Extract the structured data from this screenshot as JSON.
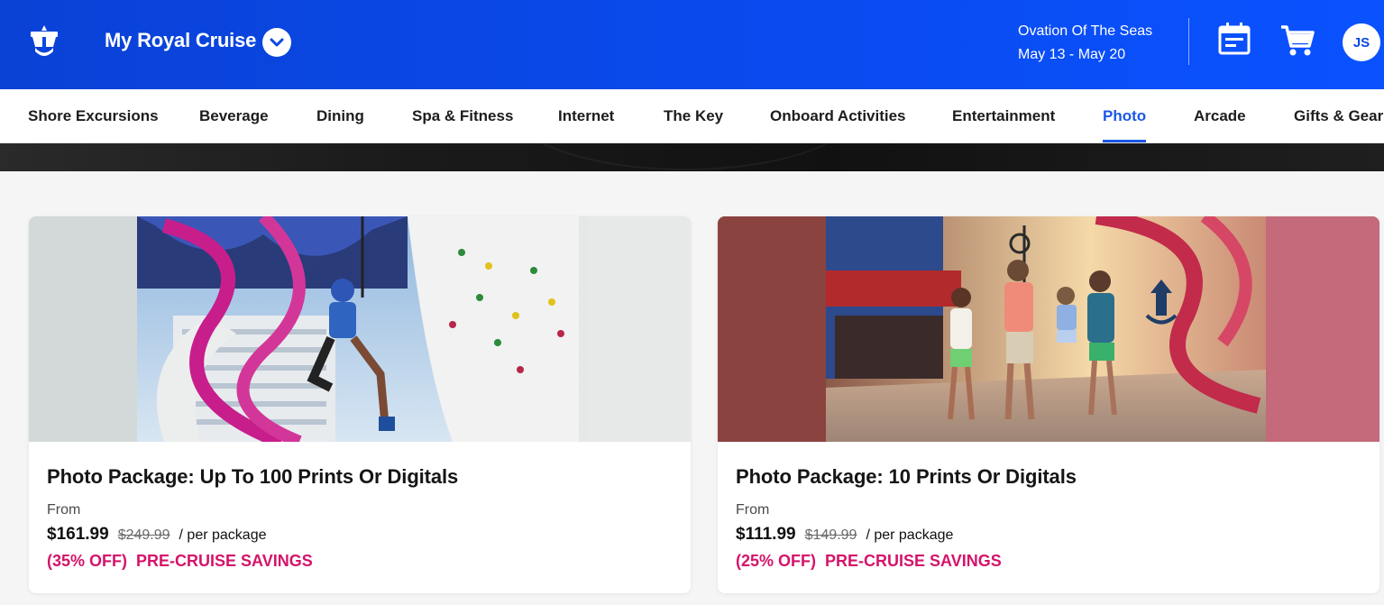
{
  "header": {
    "brand": "My Royal Cruise",
    "ship_name": "Ovation Of The Seas",
    "dates": "May 13 - May 20",
    "avatar_initials": "JS",
    "colors": {
      "header_bg": "#0a4bf0",
      "accent": "#1a57e6",
      "savings": "#d5136a"
    }
  },
  "nav": {
    "items": [
      {
        "label": "Shore Excursions"
      },
      {
        "label": "Beverage"
      },
      {
        "label": "Dining"
      },
      {
        "label": "Spa & Fitness"
      },
      {
        "label": "Internet"
      },
      {
        "label": "The Key"
      },
      {
        "label": "Onboard Activities"
      },
      {
        "label": "Entertainment"
      },
      {
        "label": "Photo",
        "active": true
      },
      {
        "label": "Arcade"
      },
      {
        "label": "Gifts & Gear"
      }
    ]
  },
  "cards": [
    {
      "title": "Photo Package: Up To 100 Prints Or Digitals",
      "from_label": "From",
      "price": "$161.99",
      "old_price": "$249.99",
      "per": "/ per package",
      "discount": "(35% OFF)",
      "savings_label": "PRE-CRUISE SAVINGS",
      "image": "girl-on-zipline-climbing-wall"
    },
    {
      "title": "Photo Package: 10 Prints Or Digitals",
      "from_label": "From",
      "price": "$111.99",
      "old_price": "$149.99",
      "per": "/ per package",
      "discount": "(25% OFF)",
      "savings_label": "PRE-CRUISE SAVINGS",
      "image": "family-walking-on-deck-at-sunset"
    }
  ]
}
